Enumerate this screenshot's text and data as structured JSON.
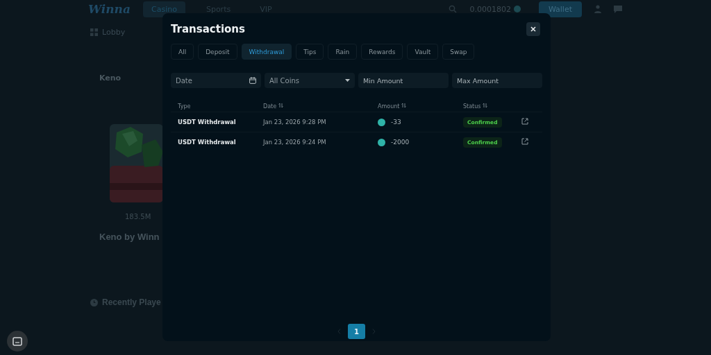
{
  "background": {
    "logo": "Winna",
    "nav": [
      {
        "label": "Casino",
        "selected": true
      },
      {
        "label": "Sports",
        "selected": false
      },
      {
        "label": "VIP",
        "selected": false
      }
    ],
    "balance": "0.0001802",
    "wallet_button": "Wallet",
    "lobby": "Lobby",
    "game_title": "Keno",
    "game_stat": "183.5M",
    "game_heading": "Keno by Winn",
    "recent_heading": "Recently Playe"
  },
  "modal": {
    "title": "Transactions",
    "tabs": [
      {
        "label": "All",
        "selected": false
      },
      {
        "label": "Deposit",
        "selected": false
      },
      {
        "label": "Withdrawal",
        "selected": true
      },
      {
        "label": "Tips",
        "selected": false
      },
      {
        "label": "Rain",
        "selected": false
      },
      {
        "label": "Rewards",
        "selected": false
      },
      {
        "label": "Vault",
        "selected": false
      },
      {
        "label": "Swap",
        "selected": false
      }
    ],
    "filters": {
      "date": {
        "placeholder": "Date"
      },
      "coin": {
        "value": "All Coins"
      },
      "min_amount": {
        "placeholder": "Min Amount"
      },
      "max_amount": {
        "placeholder": "Max Amount"
      }
    },
    "columns": [
      {
        "label": "Type",
        "sortable": false
      },
      {
        "label": "Date",
        "sortable": true
      },
      {
        "label": "Amount",
        "sortable": true
      },
      {
        "label": "Status",
        "sortable": true
      }
    ],
    "rows": [
      {
        "type": "USDT Withdrawal",
        "date": "Jan 23, 2026 9:28 PM",
        "amount": "-33",
        "status": "Confirmed"
      },
      {
        "type": "USDT Withdrawal",
        "date": "Jan 23, 2026 9:24 PM",
        "amount": "-2000",
        "status": "Confirmed"
      }
    ],
    "pages": [
      {
        "label": "1",
        "selected": true
      }
    ]
  }
}
